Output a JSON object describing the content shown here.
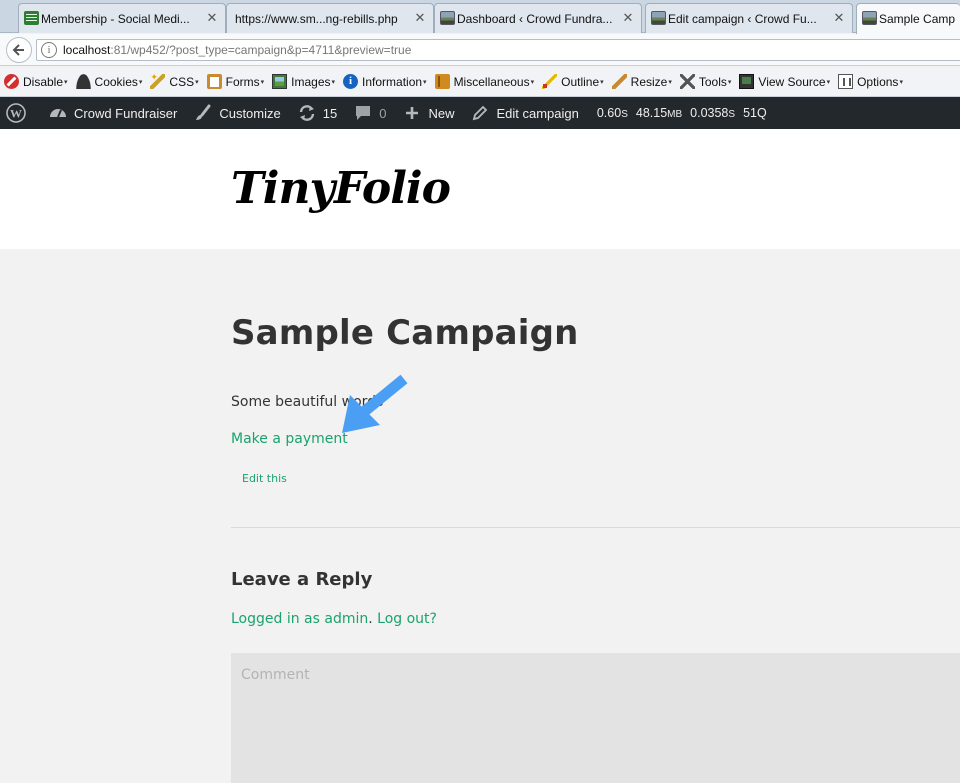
{
  "tabs": [
    {
      "title": "Membership - Social Medi...",
      "icon": "social-club-favicon"
    },
    {
      "title": "https://www.sm...ng-rebills.php",
      "icon": "none"
    },
    {
      "title": "Dashboard ‹ Crowd Fundra...",
      "icon": "landscape-favicon"
    },
    {
      "title": "Edit campaign ‹ Crowd Fu...",
      "icon": "landscape-favicon"
    },
    {
      "title": "Sample Camp",
      "icon": "landscape-favicon"
    }
  ],
  "tab_close_glyph": "✕",
  "address": {
    "host": "localhost",
    "rest": ":81/wp452/?post_type=campaign&p=4711&preview=true"
  },
  "devbar": {
    "items": [
      "Disable",
      "Cookies",
      "CSS",
      "Forms",
      "Images",
      "Information",
      "Miscellaneous",
      "Outline",
      "Resize",
      "Tools",
      "View Source",
      "Options"
    ],
    "caret": "▾"
  },
  "adminbar": {
    "site_name": "Crowd Fundraiser",
    "customize": "Customize",
    "updates_count": "15",
    "comments_count": "0",
    "new_label": "New",
    "edit_label": "Edit campaign",
    "stats": {
      "time": "0.60",
      "time_unit": "S",
      "memory": "48.15",
      "memory_unit": "MB",
      "query_time": "0.0358",
      "query_time_unit": "S",
      "queries": "51Q"
    }
  },
  "site": {
    "logo_text": "TinyFolio"
  },
  "post": {
    "title": "Sample Campaign",
    "body": "Some beautiful words",
    "payment_link": "Make a payment",
    "edit_link": "Edit this"
  },
  "comments": {
    "heading": "Leave a Reply",
    "logged_in_prefix": "Logged in as admin",
    "separator": ".",
    "logout": "Log out?",
    "placeholder": "Comment"
  },
  "colors": {
    "link": "#1aa36f",
    "admin_bar": "#23282d",
    "annotation_arrow": "#4a9ff5"
  }
}
